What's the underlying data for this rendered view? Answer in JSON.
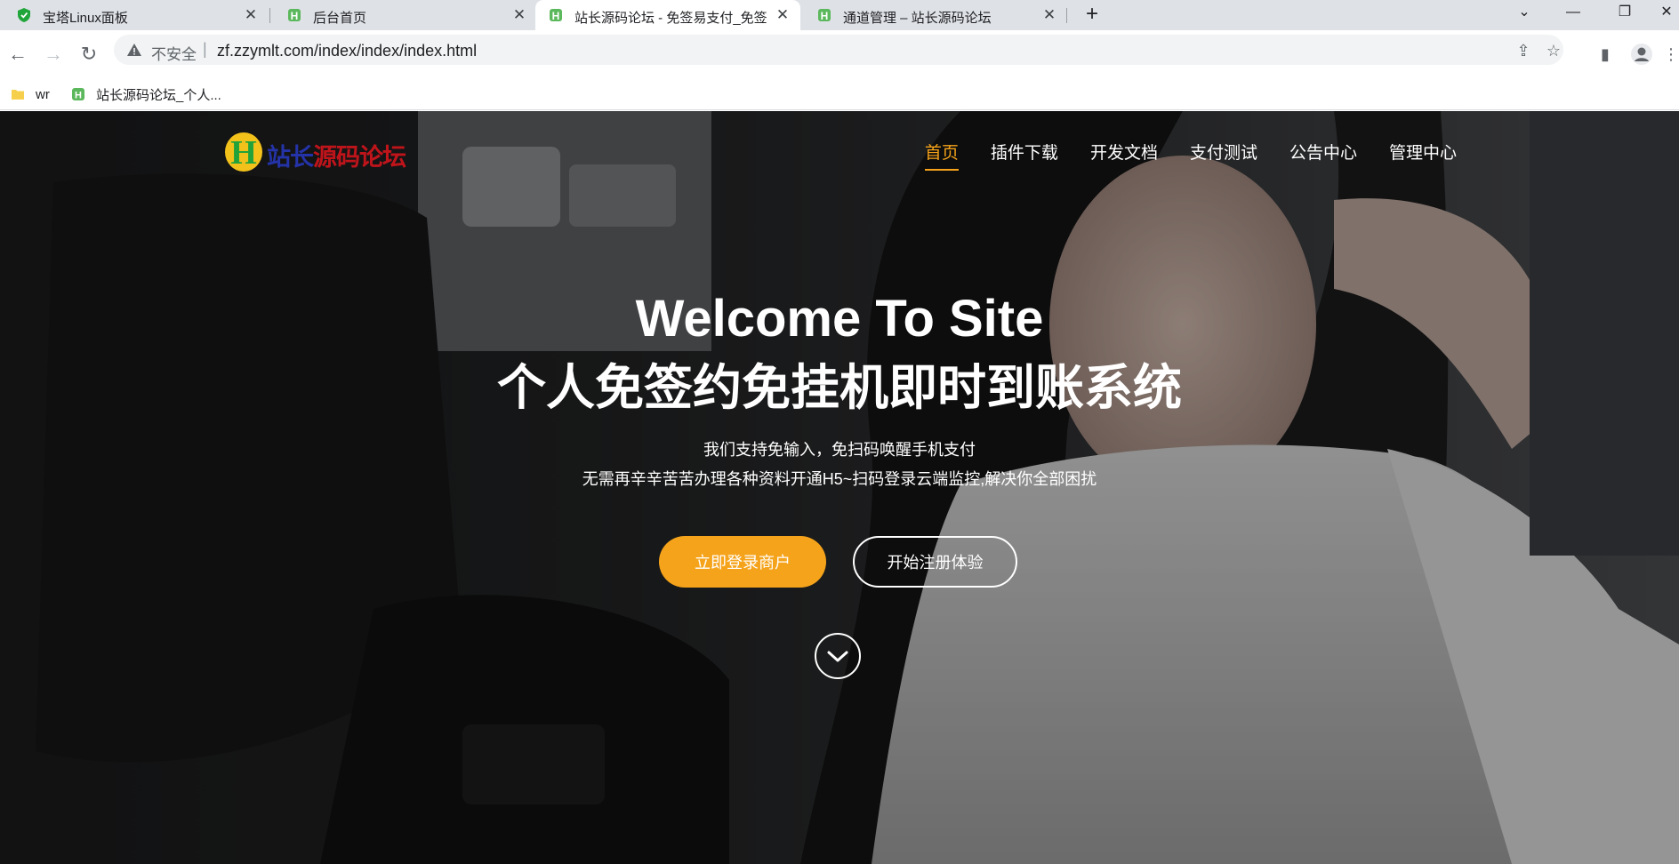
{
  "browser": {
    "tabs": [
      {
        "title": "宝塔Linux面板",
        "active": false
      },
      {
        "title": "后台首页",
        "active": false
      },
      {
        "title": "站长源码论坛 - 免签易支付_免签",
        "active": true
      },
      {
        "title": "通道管理 – 站长源码论坛",
        "active": false
      }
    ],
    "security_label": "不安全",
    "url": "zf.zzymlt.com/index/index/index.html",
    "bookmarks": [
      {
        "label": "wr"
      },
      {
        "label": "站长源码论坛_个人..."
      }
    ]
  },
  "site": {
    "logo_text": "站长源码论坛",
    "nav": [
      {
        "label": "首页",
        "active": true
      },
      {
        "label": "插件下载",
        "active": false
      },
      {
        "label": "开发文档",
        "active": false
      },
      {
        "label": "支付测试",
        "active": false
      },
      {
        "label": "公告中心",
        "active": false
      },
      {
        "label": "管理中心",
        "active": false
      }
    ],
    "hero": {
      "title_line1": "Welcome To Site",
      "title_line2": "个人免签约免挂机即时到账系统",
      "subtitle_line1": "我们支持免输入，免扫码唤醒手机支付",
      "subtitle_line2": "无需再辛辛苦苦办理各种资料开通H5~扫码登录云端监控,解决你全部困扰",
      "login_button": "立即登录商户",
      "register_button": "开始注册体验"
    }
  },
  "colors": {
    "accent": "#f5a31a",
    "tabbar": "#dee1e6",
    "omnibox": "#f1f3f4"
  }
}
